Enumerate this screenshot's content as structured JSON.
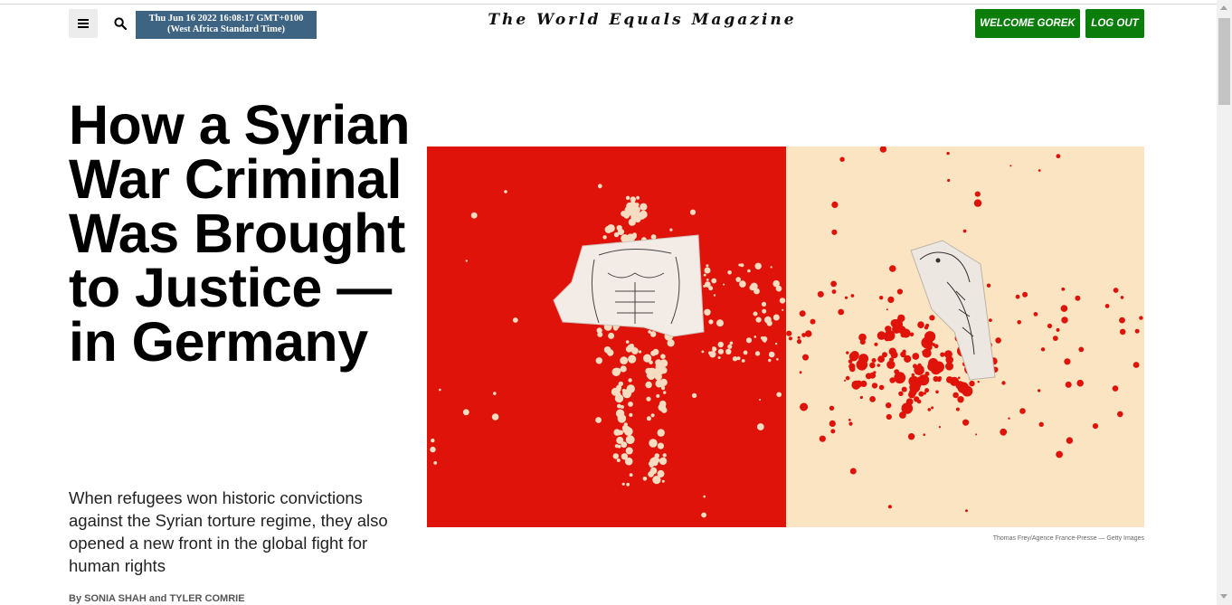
{
  "header": {
    "datetime_line1": "Thu Jun 16 2022 16:08:17 GMT+0100",
    "datetime_line2": "(West Africa Standard Time)",
    "masthead": "The World Equals Magazine",
    "welcome_label": "WELCOME GOREK",
    "logout_label": "LOG OUT",
    "menu_icon": "hamburger-icon",
    "search_icon": "search-icon"
  },
  "article": {
    "headline": "How a Syrian War Criminal Was Brought to Justice — in Germany",
    "dek": "When refugees won historic convictions against the Syrian torture regime, they also opened a new front in the global fight for human rights",
    "byline_prefix": "By ",
    "authors": "SONIA SHAH and TYLER COMRIE",
    "image_credit": "Thomas Frey/Agence France-Presse — Getty Images"
  },
  "colors": {
    "button_green": "#0a7d0a",
    "date_box": "#3e6483",
    "hero_red": "#e0130a",
    "hero_cream": "#fbe4c2"
  }
}
